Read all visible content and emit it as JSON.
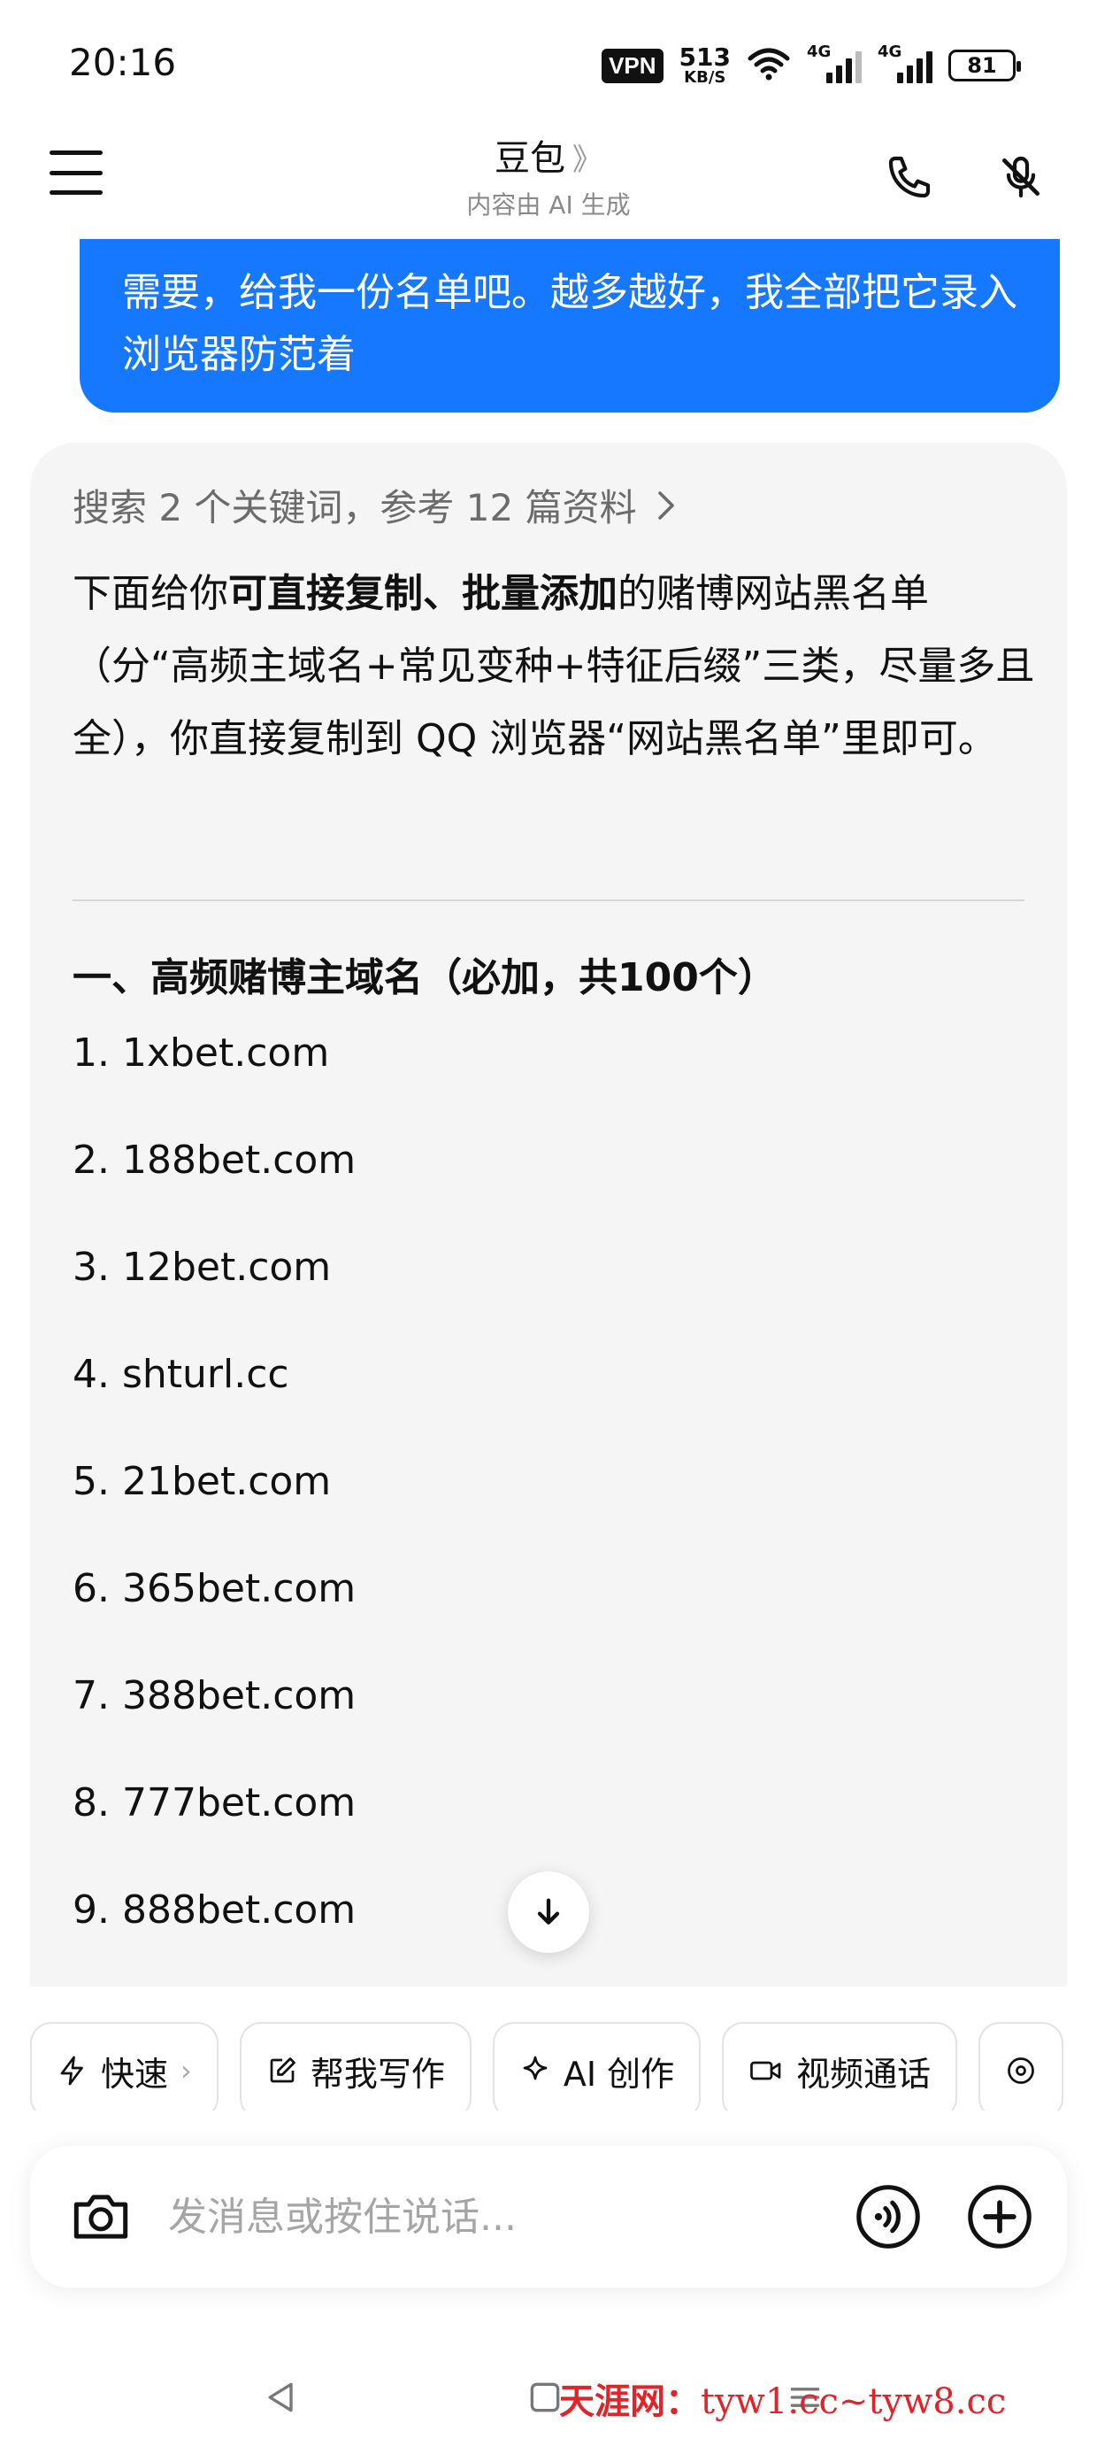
{
  "status_bar": {
    "time": "20:16",
    "vpn": "VPN",
    "speed_value": "513",
    "speed_unit": "KB/S",
    "sim1_label": "4G",
    "sim2_label": "4G",
    "battery": "81"
  },
  "header": {
    "title": "豆包",
    "title_chevron": "》",
    "subtitle": "内容由 AI 生成"
  },
  "user_message": "需要，给我一份名单吧。越多越好，我全部把它录入浏览器防范着",
  "assistant": {
    "search_summary": "搜索 2 个关键词，参考 12 篇资料",
    "intro_part1": "下面给你",
    "intro_bold1": "可直接复制、",
    "intro_bold2": "批量添加",
    "intro_part2": "的赌博网站黑名单（分“高频主域名+常见变种+特征后缀”三类，尽量多且全），你直接复制到 QQ 浏览器“网站黑名单”里即可。",
    "section_title": "一、高频赌博主域名（必加，共100个）",
    "domains": [
      "1. 1xbet.com",
      "2. 188bet.com",
      "3. 12bet.com",
      "4. shturl.cc",
      "5. 21bet.com",
      "6. 365bet.com",
      "7. 388bet.com",
      "8. 777bet.com",
      "9. 888bet.com"
    ]
  },
  "chips": [
    {
      "label": "快速",
      "icon": "lightning-icon"
    },
    {
      "label": "帮我写作",
      "icon": "edit-icon"
    },
    {
      "label": "AI 创作",
      "icon": "sparkle-icon"
    },
    {
      "label": "视频通话",
      "icon": "video-icon"
    }
  ],
  "input": {
    "placeholder": "发消息或按住说话..."
  },
  "watermark": {
    "site": "天涯网：",
    "urls": "tyw1.cc~tyw8.cc"
  },
  "colors": {
    "accent": "#1677ff",
    "card_bg": "#f5f5f5",
    "watermark": "#e0242a"
  }
}
